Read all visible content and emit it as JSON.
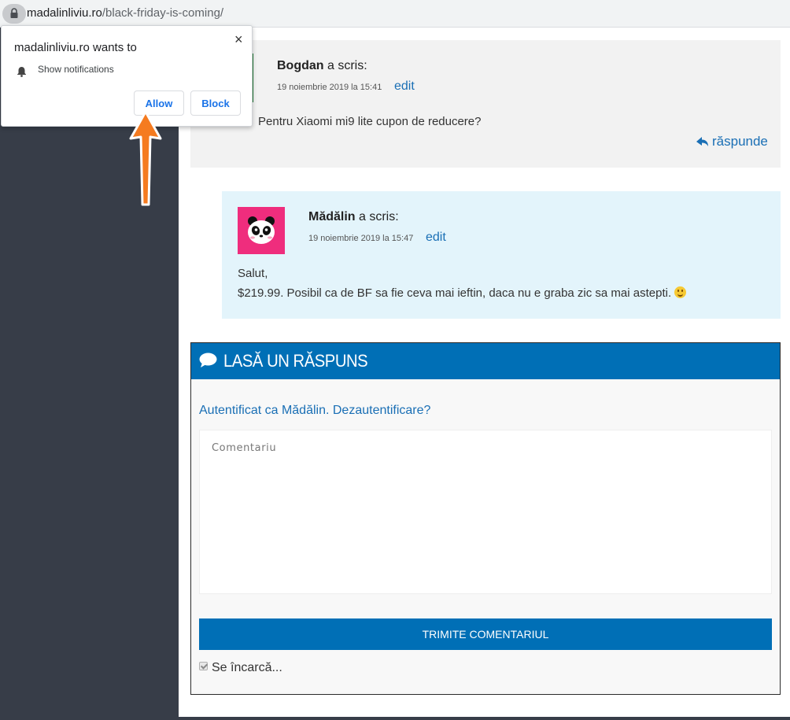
{
  "browser": {
    "url_domain": "madalinliviu.ro",
    "url_path": "/black-friday-is-coming/"
  },
  "notification_prompt": {
    "title": "madalinliviu.ro wants to",
    "close_glyph": "×",
    "permission_icon": "bell-icon",
    "permission": "Show notifications",
    "allow_label": "Allow",
    "block_label": "Block"
  },
  "comments": [
    {
      "author": "Bogdan",
      "said": " a scris:",
      "date": "19 noiembrie 2019 la 15:41",
      "edit_label": "edit",
      "text": "Pentru Xiaomi mi9 lite cupon de reducere?",
      "reply_label": "răspunde"
    },
    {
      "author": "Mădălin",
      "said": " a scris:",
      "date": "19 noiembrie 2019 la 15:47",
      "edit_label": "edit",
      "line1": "Salut,",
      "line2": "$219.99. Posibil ca de BF sa fie ceva mai ieftin, daca nu e graba zic sa mai astepti.",
      "emoji": "smiley-emoji"
    }
  ],
  "reply_form": {
    "header": "LASĂ UN RĂSPUNS",
    "logged_in_as": "Autentificat ca Mădălin.",
    "logout": "Dezautentificare?",
    "comment_placeholder": "Comentariu",
    "submit_label": "TRIMITE COMENTARIUL",
    "loading": "Se încarcă..."
  },
  "colors": {
    "sidebar": "#373d48",
    "accent": "#006fb6",
    "link": "#1a6fb5",
    "comment_highlight": "#e3f4fb",
    "annotation_arrow": "#f57b20"
  }
}
